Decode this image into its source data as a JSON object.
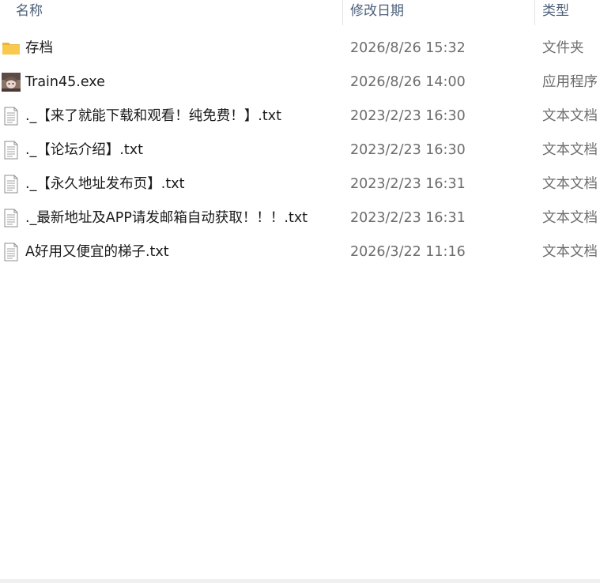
{
  "columns": {
    "name": "名称",
    "date": "修改日期",
    "type": "类型"
  },
  "files": [
    {
      "name": "存档",
      "date": "2026/8/26 15:32",
      "type": "文件夹",
      "icon": "folder-icon"
    },
    {
      "name": "Train45.exe",
      "date": "2026/8/26 14:00",
      "type": "应用程序",
      "icon": "app-icon"
    },
    {
      "name": "._【来了就能下载和观看！纯免费！】.txt",
      "date": "2023/2/23 16:30",
      "type": "文本文档",
      "icon": "text-file-icon"
    },
    {
      "name": "._【论坛介绍】.txt",
      "date": "2023/2/23 16:30",
      "type": "文本文档",
      "icon": "text-file-icon"
    },
    {
      "name": "._【永久地址发布页】.txt",
      "date": "2023/2/23 16:31",
      "type": "文本文档",
      "icon": "text-file-icon"
    },
    {
      "name": "._最新地址及APP请发邮箱自动获取！！！.txt",
      "date": "2023/2/23 16:31",
      "type": "文本文档",
      "icon": "text-file-icon"
    },
    {
      "name": "A好用又便宜的梯子.txt",
      "date": "2026/3/22 11:16",
      "type": "文本文档",
      "icon": "text-file-icon"
    }
  ],
  "colors": {
    "header_text": "#4c607a",
    "name_text": "#1a1a1a",
    "meta_text": "#6d6d6d",
    "folder_yellow": "#f8c94a"
  }
}
